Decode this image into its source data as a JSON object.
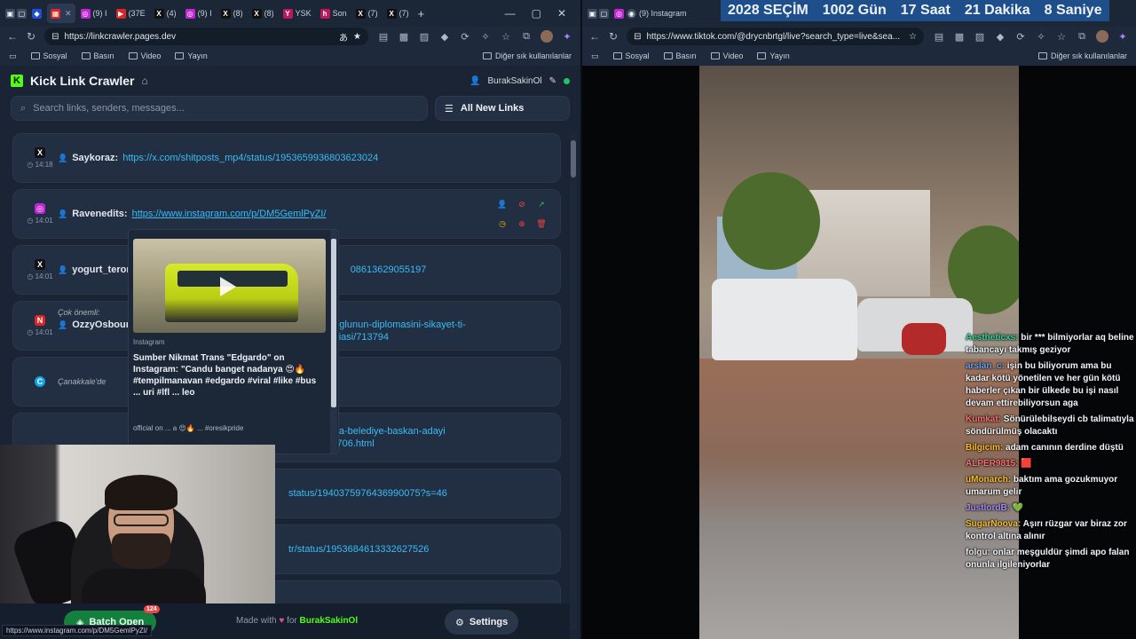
{
  "left_browser": {
    "tabs": [
      "",
      "",
      "(9) I",
      "(37E",
      "(4)",
      "(9) I",
      "(8)",
      "(8)",
      "YSK",
      "Son",
      "(7)",
      "(7)"
    ],
    "url": "https://linkcrawler.pages.dev",
    "bookmarks": [
      "Sosyal",
      "Basın",
      "Video",
      "Yayın"
    ],
    "bookmarks_right": "Diğer sık kullanılanlar",
    "status_url": "https://www.instagram.com/p/DM5GemlPyZI/"
  },
  "right_browser": {
    "tab_label": "(9) Instagram",
    "url": "https://www.tiktok.com/@drycnbrtgl/live?search_type=live&sea...",
    "bookmarks": [
      "Sosyal",
      "Basın",
      "Video",
      "Yayın"
    ],
    "bookmarks_right": "Diğer sık kullanılanlar"
  },
  "countdown": {
    "label_year": "2028",
    "label_event": "SEÇİM",
    "days": "1002",
    "days_unit": "Gün",
    "hours": "17",
    "hours_unit": "Saat",
    "minutes": "21",
    "minutes_unit": "Dakika",
    "seconds": "8",
    "seconds_unit": "Saniye"
  },
  "app": {
    "title": "Kick Link Crawler",
    "user": "BurakSakinOl",
    "search_placeholder": "Search links, senders, messages...",
    "filter_label": "All New Links",
    "links": [
      {
        "platform": "X",
        "time": "14:18",
        "note": "",
        "sender": "Saykoraz:",
        "url": "https://x.com/shitposts_mp4/status/1953659936803623024"
      },
      {
        "platform": "IG",
        "time": "14:01",
        "note": "",
        "sender": "Ravenedits:",
        "url": "https://www.instagram.com/p/DM5GemlPyZI/"
      },
      {
        "platform": "X",
        "time": "14:01",
        "note": "",
        "sender": "yogurt_terori",
        "url": "08613629055197"
      },
      {
        "platform": "N",
        "time": "14:01",
        "note": "Çok önemli:",
        "sender": "OzzyOsbour",
        "url": "moglunun-diplomasini-sikayet-ti-iddiasi/713794"
      },
      {
        "platform": "C",
        "time": "",
        "note": "Çanakkale'de",
        "sender": "",
        "url": ""
      },
      {
        "platform": "",
        "time": "",
        "note": "",
        "sender": "",
        "url": "ynarca-belediye-baskan-adayi",
        "url2": "ndi-9706.html"
      },
      {
        "platform": "",
        "time": "",
        "note": "",
        "sender": "",
        "url": "status/1940375976436990075?s=46"
      },
      {
        "platform": "",
        "time": "",
        "note": "",
        "sender": "",
        "url": "tr/status/1953684613332627526"
      },
      {
        "platform": "",
        "time": "",
        "note": "",
        "sender": "",
        "url": ""
      }
    ],
    "preview": {
      "source": "Instagram",
      "title": "Sumber Nikmat Trans \"Edgardo\" on Instagram: \"Candu banget nadanya 😍🔥 #tempilmanavan #edgardo #viral #like #bus ... uri #lfl ... leo",
      "desc": "official on ... a 😍🔥 ... #oresikpride"
    },
    "batch_label": "Batch Open",
    "batch_count": "124",
    "footer_made": "Made with",
    "footer_for": "for",
    "footer_user": "BurakSakinOl",
    "settings_label": "Settings"
  },
  "chat": [
    {
      "user": "Aestheticxs:",
      "color": "#34d399",
      "text": "bir *** bilmiyorlar aq beline tabancayı takmış geziyor"
    },
    {
      "user": "arslan_c:",
      "color": "#60a5fa",
      "text": "işin bu biliyorum ama bu kadar kötü yönetilen ve her gün kötü haberler çıkan bir ülkede bu işi nasıl devam ettirebiliyorsun aga"
    },
    {
      "user": "Kumkat:",
      "color": "#f87171",
      "text": "Sönürülebilseydi cb talimatıyla söndürülmüş olacaktı"
    },
    {
      "user": "Bilgicim:",
      "color": "#fbbf24",
      "text": "adam canının derdine düştü"
    },
    {
      "user": "ALPER9815:",
      "color": "#f87171",
      "text": "🟥"
    },
    {
      "user": "uMonarch:",
      "color": "#fbbf24",
      "text": "baktım ama gozukmuyor umarum gelir"
    },
    {
      "user": "JustlordB:",
      "color": "#a78bfa",
      "text": "💚"
    },
    {
      "user": "SugarNoova:",
      "color": "#fbbf24",
      "text": "Aşırı rüzgar var biraz zor kontrol altına alınır"
    },
    {
      "user": "folgu:",
      "color": "#e5e7eb",
      "text": "onlar meşguldür şimdi apo falan onunla ilgileniyorlar"
    }
  ],
  "colors": {
    "accent": "#53fc18",
    "link": "#38bdf8",
    "countdown_bg": "#1f4f8a"
  }
}
